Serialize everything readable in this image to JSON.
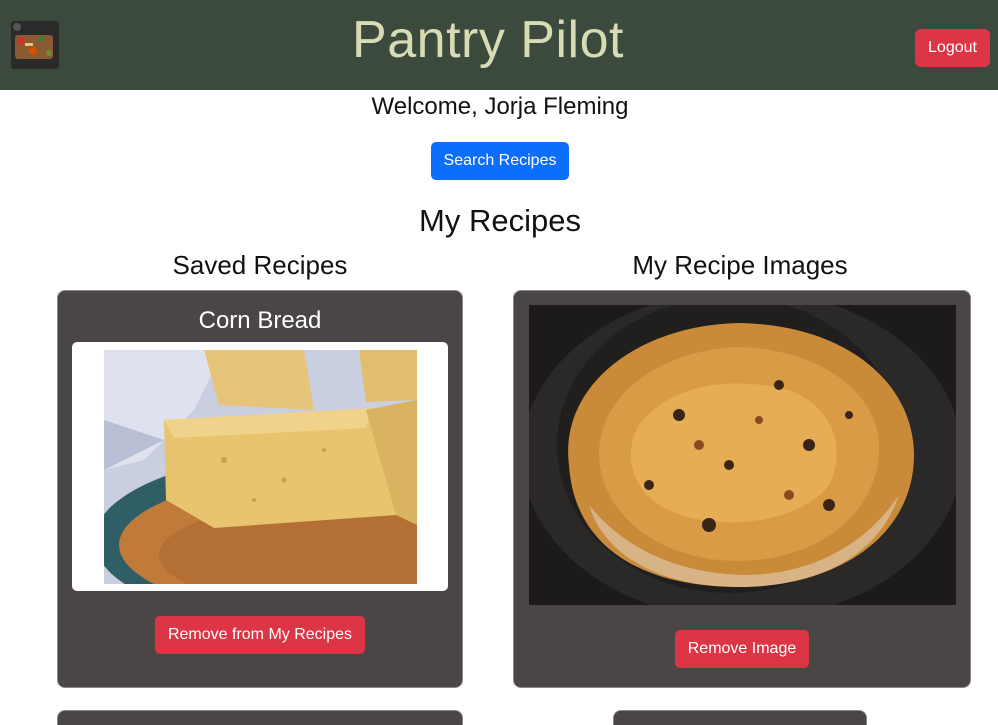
{
  "header": {
    "title": "Pantry Pilot",
    "logout_label": "Logout"
  },
  "welcome_text": "Welcome, Jorja Fleming",
  "search_button_label": "Search Recipes",
  "section_title": "My Recipes",
  "saved_recipes": {
    "heading": "Saved Recipes",
    "items": [
      {
        "title": "Corn Bread",
        "remove_label": "Remove from My Recipes"
      }
    ]
  },
  "recipe_images": {
    "heading": "My Recipe Images",
    "items": [
      {
        "remove_label": "Remove Image"
      }
    ]
  },
  "colors": {
    "navbar": "#3b4a3d",
    "title": "#d8dcb4",
    "danger": "#dc3545",
    "primary": "#0d6efd",
    "card": "#4a4646"
  }
}
